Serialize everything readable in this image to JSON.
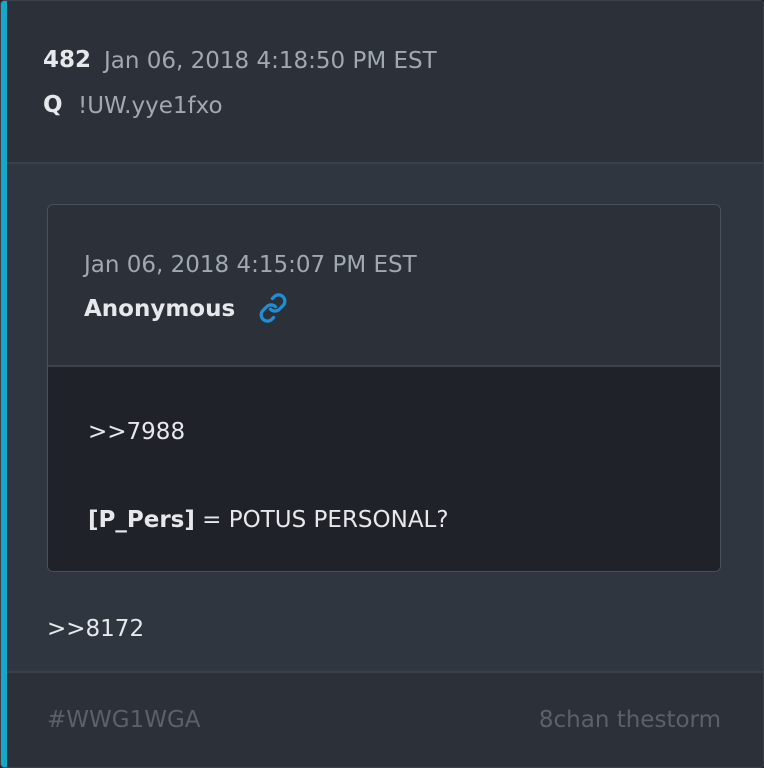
{
  "post": {
    "number": "482",
    "date": "Jan 06, 2018 4:18:50 PM EST",
    "author": "Q",
    "tripcode": "!UW.yye1fxo"
  },
  "quoted_post": {
    "date": "Jan 06, 2018 4:15:07 PM EST",
    "author": "Anonymous",
    "link_icon": "link-icon",
    "reference": ">>7988",
    "tag": "[P_Pers]",
    "text": " = POTUS PERSONAL?"
  },
  "reply": {
    "reference": ">>8172"
  },
  "footer": {
    "hashtag": "#WWG1WGA",
    "source": "8chan thestorm"
  },
  "colors": {
    "accent": "#17a7c8",
    "link": "#1e8fd6"
  }
}
